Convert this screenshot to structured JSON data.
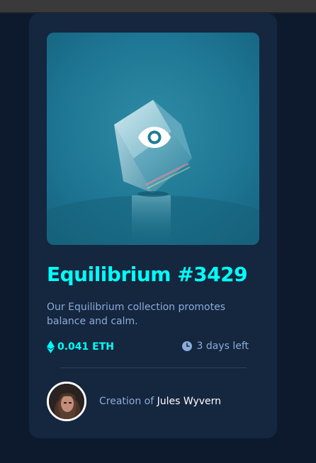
{
  "card": {
    "title": "Equilibrium #3429",
    "description": "Our Equilibrium collection promotes balance and calm.",
    "price": "0.041 ETH",
    "time_left": "3 days left",
    "creator_prefix": "Creation of",
    "creator_name": "Jules Wyvern"
  },
  "icons": {
    "overlay": "eye-icon",
    "price": "ethereum-icon",
    "time": "clock-icon"
  },
  "colors": {
    "page_background": "#0d1a2e",
    "card_background": "#15263f",
    "accent_cyan": "#00fff8",
    "soft_blue": "#8bacd9",
    "white": "#ffffff",
    "divider": "#2e405a"
  }
}
